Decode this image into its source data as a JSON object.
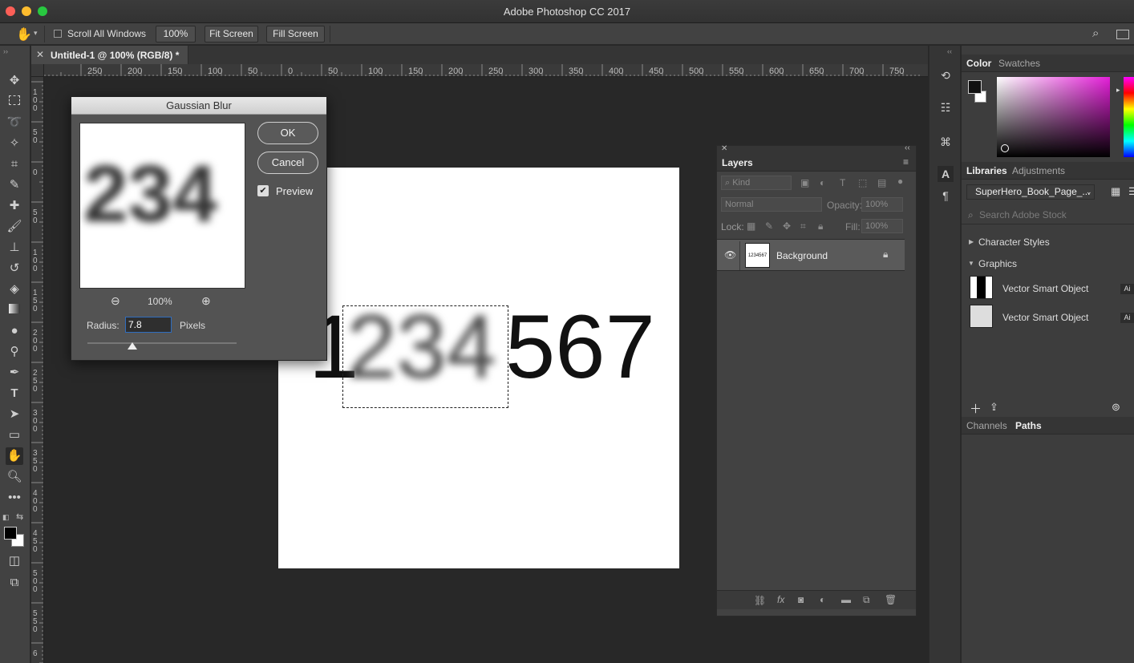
{
  "app": {
    "title": "Adobe Photoshop CC 2017"
  },
  "options_bar": {
    "scroll_all_windows": "Scroll All Windows",
    "zoom": "100%",
    "fit_screen": "Fit Screen",
    "fill_screen": "Fill Screen"
  },
  "document": {
    "tab_title": "Untitled-1 @ 100% (RGB/8) *",
    "canvas_text_left": "1",
    "canvas_text_blurred": "234",
    "canvas_text_right": "567",
    "ruler_labels": [
      "250",
      "200",
      "150",
      "100",
      "50",
      "0",
      "50",
      "100",
      "150",
      "200",
      "250",
      "300",
      "350",
      "400",
      "450",
      "500",
      "550",
      "600",
      "650",
      "700",
      "750"
    ],
    "vruler_labels": [
      "1\n0\n0",
      "5\n0",
      "0",
      "5\n0",
      "1\n0\n0",
      "1\n5\n0",
      "2\n0\n0",
      "2\n5\n0",
      "3\n0\n0",
      "3\n5\n0",
      "4\n0\n0",
      "4\n5\n0",
      "5\n0\n0",
      "5\n5\n0",
      "6"
    ]
  },
  "gaussian_blur": {
    "title": "Gaussian Blur",
    "ok": "OK",
    "cancel": "Cancel",
    "preview_label": "Preview",
    "preview_checked": true,
    "preview_text": "234",
    "zoom": "100%",
    "radius_label": "Radius:",
    "radius_value": "7.8",
    "radius_unit": "Pixels",
    "slider_position": 0.3
  },
  "panels": {
    "color_tab": "Color",
    "swatches_tab": "Swatches",
    "libraries_tab": "Libraries",
    "adjustments_tab": "Adjustments",
    "library_name": "SuperHero_Book_Page_...",
    "search_placeholder": "Search Adobe Stock",
    "character_styles": "Character Styles",
    "graphics": "Graphics",
    "graphics_items": [
      "Vector Smart Object",
      "Vector Smart Object"
    ],
    "graphics_badge": "Ai",
    "channels_tab": "Channels",
    "paths_tab": "Paths"
  },
  "layers": {
    "title": "Layers",
    "kind": "Kind",
    "blend_mode": "Normal",
    "opacity_label": "Opacity:",
    "opacity_value": "100%",
    "lock_label": "Lock:",
    "fill_label": "Fill:",
    "fill_value": "100%",
    "layer_name": "Background",
    "thumb_text": "1234567"
  },
  "colors": {
    "app_bg": "#282828",
    "panel": "#424242",
    "selection": "#2f6dbf"
  }
}
